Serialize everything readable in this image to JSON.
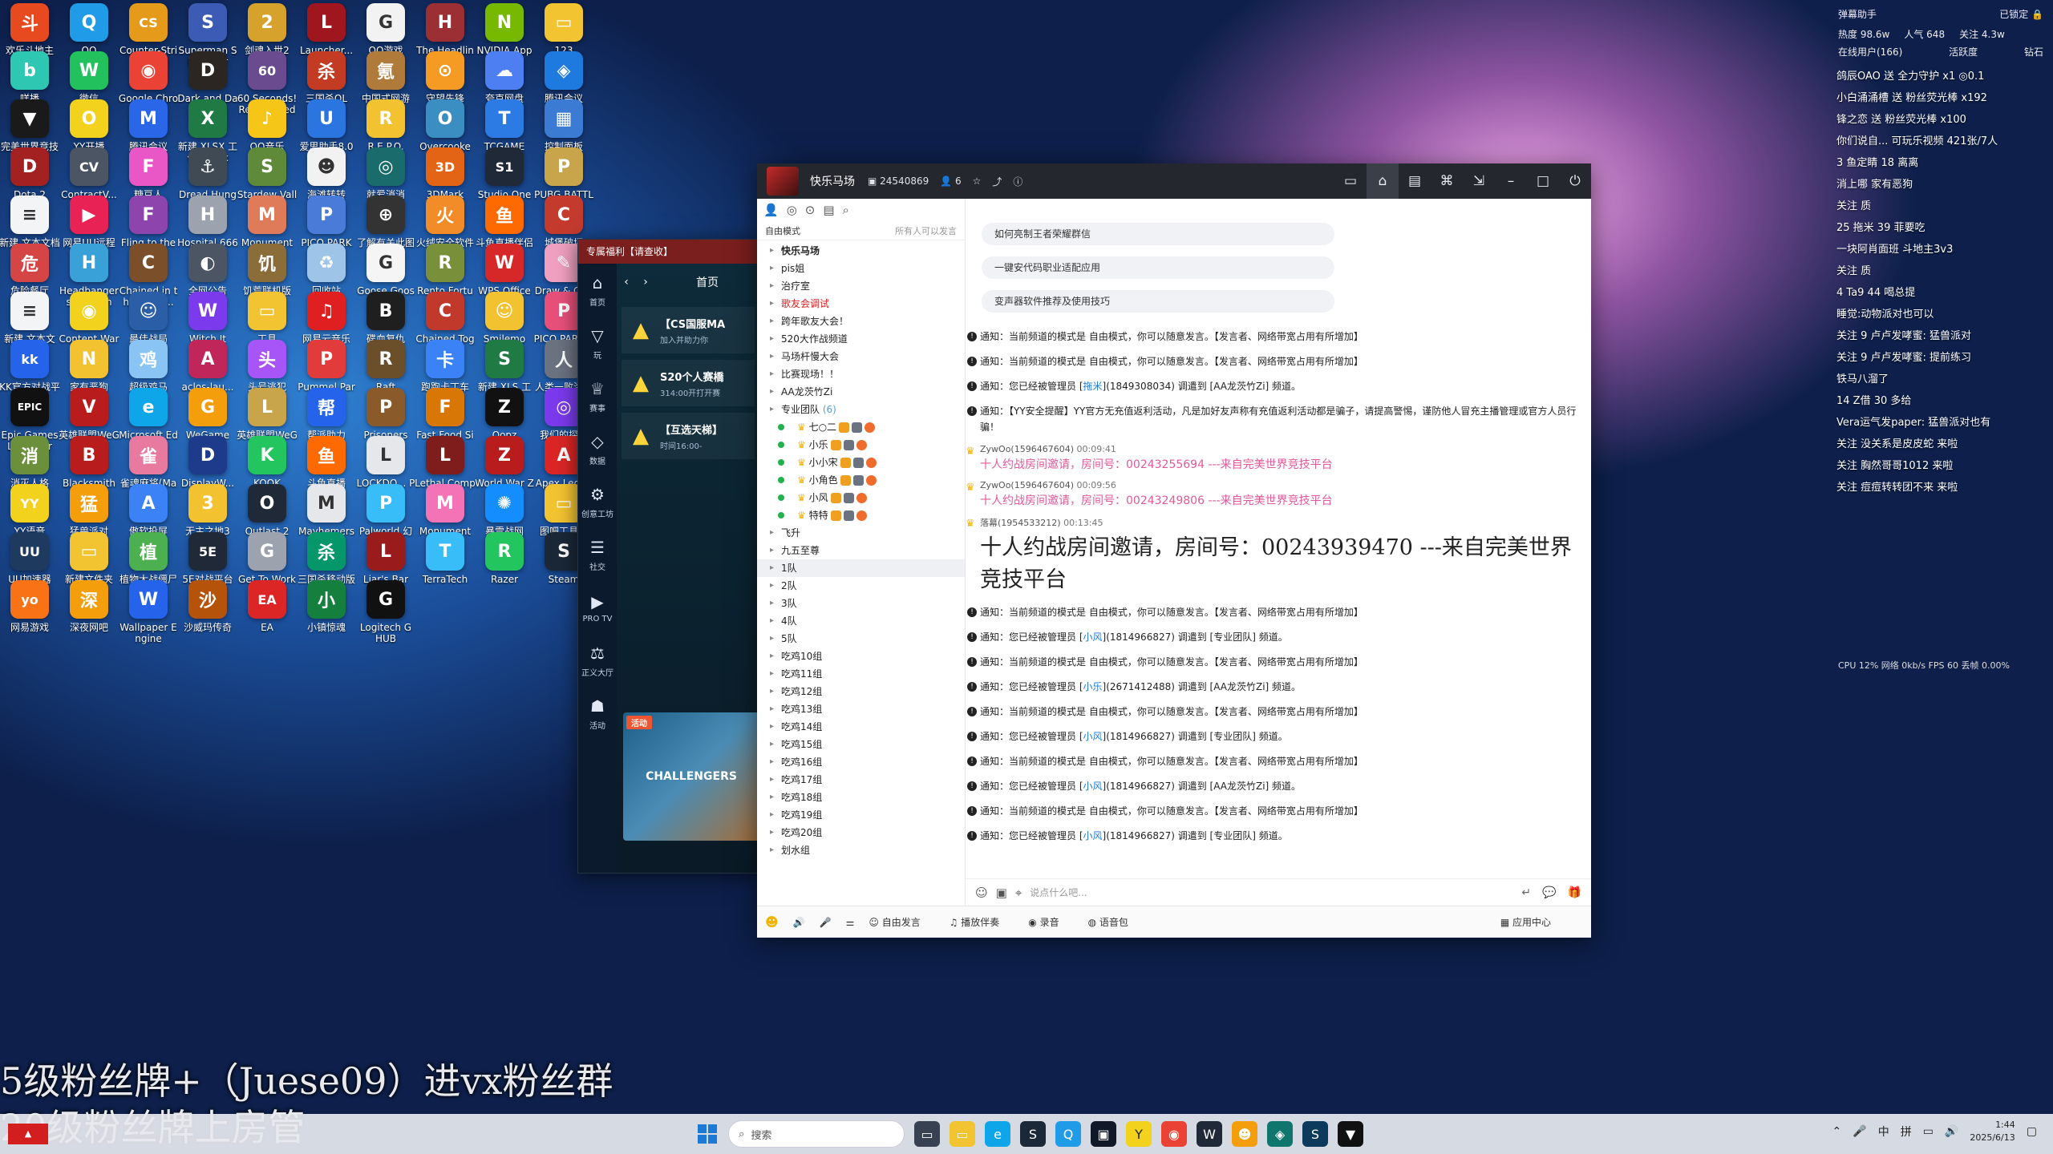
{
  "desktop_icons": [
    {
      "label": "欢乐斗地主",
      "color": "#e84a1f",
      "glyph": "斗"
    },
    {
      "label": "QQ",
      "color": "#1f9be8",
      "glyph": "Q"
    },
    {
      "label": "Counter-Strike 2",
      "color": "#e59a1a",
      "glyph": "CS"
    },
    {
      "label": "Superman Simulator",
      "color": "#3b5bb5",
      "glyph": "S"
    },
    {
      "label": "剑魂入世2",
      "color": "#d7a22b",
      "glyph": "2"
    },
    {
      "label": "Launcher...",
      "color": "#a0161f",
      "glyph": "L"
    },
    {
      "label": "QQ游戏",
      "color": "#f2f2f2",
      "glyph": "G"
    },
    {
      "label": "The Headliners",
      "color": "#9b2f33",
      "glyph": "H"
    },
    {
      "label": "NVIDIA App",
      "color": "#76b900",
      "glyph": "N"
    },
    {
      "label": "123",
      "color": "#f3c431",
      "glyph": "▭"
    },
    {
      "label": "咩播",
      "color": "#2dc7b2",
      "glyph": "b"
    },
    {
      "label": "微信",
      "color": "#22c15e",
      "glyph": "W"
    },
    {
      "label": "Google Chrome",
      "color": "#ea4335",
      "glyph": "◉"
    },
    {
      "label": "Dark and Darker",
      "color": "#2b2622",
      "glyph": "D"
    },
    {
      "label": "60 Seconds! Reatomized",
      "color": "#6a4b8f",
      "glyph": "60"
    },
    {
      "label": "三国杀OL",
      "color": "#c23b22",
      "glyph": "杀"
    },
    {
      "label": "中国式网游",
      "color": "#b07a3a",
      "glyph": "氪"
    },
    {
      "label": "守望先锋",
      "color": "#f59a23",
      "glyph": "⊙"
    },
    {
      "label": "夸克网盘",
      "color": "#4d7ef2",
      "glyph": "☁"
    },
    {
      "label": "腾讯会议",
      "color": "#1f7ae0",
      "glyph": "◈"
    },
    {
      "label": "完美世界竞技平台",
      "color": "#1a1a1a",
      "glyph": "▼"
    },
    {
      "label": "YY开播",
      "color": "#f2d21c",
      "glyph": "O"
    },
    {
      "label": "腾讯会议",
      "color": "#2a66e8",
      "glyph": "M"
    },
    {
      "label": "新建 XLSX 工作表.xlsx",
      "color": "#1f7a43",
      "glyph": "X"
    },
    {
      "label": "QQ音乐",
      "color": "#f5c518",
      "glyph": "♪"
    },
    {
      "label": "爱思助手8.0(64位)",
      "color": "#2a75e0",
      "glyph": "U"
    },
    {
      "label": "R.E.P.O.",
      "color": "#f2c230",
      "glyph": "R"
    },
    {
      "label": "Overcooked! 2",
      "color": "#3a8ec2",
      "glyph": "O"
    },
    {
      "label": "TCGAME",
      "color": "#2c7be5",
      "glyph": "T"
    },
    {
      "label": "控制面板",
      "color": "#3b7bd4",
      "glyph": "▦"
    },
    {
      "label": "Dota 2",
      "color": "#a32120",
      "glyph": "D"
    },
    {
      "label": "ContractV...",
      "color": "#4b5563",
      "glyph": "CV"
    },
    {
      "label": "糖豆人",
      "color": "#e957c7",
      "glyph": "F"
    },
    {
      "label": "Dread Hunger",
      "color": "#3f4a55",
      "glyph": "⚓"
    },
    {
      "label": "Stardew Valley",
      "color": "#5f8a3a",
      "glyph": "S"
    },
    {
      "label": "海滩转转",
      "color": "#f2f2f2",
      "glyph": "☻"
    },
    {
      "label": "就爱消消",
      "color": "#1a6b6b",
      "glyph": "◎"
    },
    {
      "label": "3DMark",
      "color": "#e36414",
      "glyph": "3D"
    },
    {
      "label": "Studio One 5",
      "color": "#1f2937",
      "glyph": "S1"
    },
    {
      "label": "PUBG BATTLEGR...",
      "color": "#c8a44a",
      "glyph": "P"
    },
    {
      "label": "新建 文本文档 (2).txt",
      "color": "#f3f4f6",
      "glyph": "≡"
    },
    {
      "label": "网易UU远程控制",
      "color": "#e82255",
      "glyph": "▶"
    },
    {
      "label": "Fling to the Finish",
      "color": "#8e44ad",
      "glyph": "F"
    },
    {
      "label": "Hospital 666",
      "color": "#9ca3af",
      "glyph": "H"
    },
    {
      "label": "Monument Valley",
      "color": "#e07b5a",
      "glyph": "M"
    },
    {
      "label": "PICO PARK",
      "color": "#4a7bd8",
      "glyph": "P"
    },
    {
      "label": "了解有关此图片的信息",
      "color": "#333",
      "glyph": "⊕"
    },
    {
      "label": "火绒安全软件",
      "color": "#f28c28",
      "glyph": "火"
    },
    {
      "label": "斗鱼直播伴侣",
      "color": "#ff6a00",
      "glyph": "鱼"
    },
    {
      "label": "城堡破坏",
      "color": "#c43b2e",
      "glyph": "C"
    },
    {
      "label": "危险餐厅",
      "color": "#d64545",
      "glyph": "危"
    },
    {
      "label": "Headbangers Rhythm R...",
      "color": "#3aa0d8",
      "glyph": "H"
    },
    {
      "label": "Chained in the Backr...",
      "color": "#7a4f2a",
      "glyph": "C"
    },
    {
      "label": "全网公告",
      "color": "#4b5563",
      "glyph": "◐"
    },
    {
      "label": "饥荒联机版",
      "color": "#8b6d3a",
      "glyph": "饥"
    },
    {
      "label": "回收站",
      "color": "#9ec5e8",
      "glyph": "♻"
    },
    {
      "label": "Goose Goose Duck",
      "color": "#f5f5f5",
      "glyph": "G"
    },
    {
      "label": "Rento Fortune -...",
      "color": "#7a8f3a",
      "glyph": "R"
    },
    {
      "label": "WPS Office",
      "color": "#d62828",
      "glyph": "W"
    },
    {
      "label": "Draw & Guess -...",
      "color": "#f0a0c0",
      "glyph": "✎"
    },
    {
      "label": "新建 文本文档.txt",
      "color": "#f3f4f6",
      "glyph": "≡"
    },
    {
      "label": "Content Warning",
      "color": "#f2d21c",
      "glyph": "◉"
    },
    {
      "label": "最佳战局",
      "color": "#2a5fa8",
      "glyph": "☺"
    },
    {
      "label": "Witch It",
      "color": "#7c3aed",
      "glyph": "W"
    },
    {
      "label": "工具",
      "color": "#f3c431",
      "glyph": "▭"
    },
    {
      "label": "网易云音乐",
      "color": "#e02020",
      "glyph": "♫"
    },
    {
      "label": "碟血复仇",
      "color": "#1f1f1f",
      "glyph": "B"
    },
    {
      "label": "Chained Together",
      "color": "#c0392b",
      "glyph": "C"
    },
    {
      "label": "Smilemo",
      "color": "#f2c230",
      "glyph": "☺"
    },
    {
      "label": "PICO PARK 2",
      "color": "#e8507a",
      "glyph": "P"
    },
    {
      "label": "KK官方对战平台",
      "color": "#2563eb",
      "glyph": "kk"
    },
    {
      "label": "家有恶狗",
      "color": "#f2c230",
      "glyph": "N"
    },
    {
      "label": "超级鸡马",
      "color": "#89c4f4",
      "glyph": "鸡"
    },
    {
      "label": "aclos-lau...",
      "color": "#c0265a",
      "glyph": "A"
    },
    {
      "label": "头号逃犯",
      "color": "#a855f7",
      "glyph": "头"
    },
    {
      "label": "Pummel Party",
      "color": "#e23b3b",
      "glyph": "P"
    },
    {
      "label": "Raft",
      "color": "#6b4f2a",
      "glyph": "R"
    },
    {
      "label": "跑跑卡丁车",
      "color": "#3b82f6",
      "glyph": "卡"
    },
    {
      "label": "新建 XLS 工作表.xls",
      "color": "#1f7a43",
      "glyph": "S"
    },
    {
      "label": "人类一败涂地 Hum...",
      "color": "#6b7280",
      "glyph": "人"
    },
    {
      "label": "Epic Games Launcher",
      "color": "#111",
      "glyph": "EPIC"
    },
    {
      "label": "英雄联盟WeGame版",
      "color": "#b91c1c",
      "glyph": "V"
    },
    {
      "label": "Microsoft Edge",
      "color": "#0ea5e9",
      "glyph": "e"
    },
    {
      "label": "WeGame",
      "color": "#f59e0b",
      "glyph": "G"
    },
    {
      "label": "英雄联盟WeGame版",
      "color": "#c8a44a",
      "glyph": "L"
    },
    {
      "label": "帮派助力",
      "color": "#2563eb",
      "glyph": "帮"
    },
    {
      "label": "Prisoners",
      "color": "#8b5a2b",
      "glyph": "P"
    },
    {
      "label": "Fast Food Simulat...",
      "color": "#d97706",
      "glyph": "F"
    },
    {
      "label": "Oopz",
      "color": "#111",
      "glyph": "Z"
    },
    {
      "label": "我们的探测",
      "color": "#7c3aed",
      "glyph": "◎"
    },
    {
      "label": "消灭人格",
      "color": "#6b8f3a",
      "glyph": "消"
    },
    {
      "label": "Blacksmith",
      "color": "#b91c1c",
      "glyph": "B"
    },
    {
      "label": "雀魂麻将(Mahjong...",
      "color": "#e87aa0",
      "glyph": "雀"
    },
    {
      "label": "DisplayW... Center",
      "color": "#1e3a8a",
      "glyph": "D"
    },
    {
      "label": "KOOK",
      "color": "#22c55e",
      "glyph": "K"
    },
    {
      "label": "斗鱼直播",
      "color": "#ff6a00",
      "glyph": "鱼"
    },
    {
      "label": "LOCKDO... Protocol",
      "color": "#e5e7eb",
      "glyph": "L"
    },
    {
      "label": "Lethal Company",
      "color": "#7f1d1d",
      "glyph": "L"
    },
    {
      "label": "World War Z",
      "color": "#b91c1c",
      "glyph": "Z"
    },
    {
      "label": "Apex Legends",
      "color": "#dc2626",
      "glyph": "A"
    },
    {
      "label": "YY语音",
      "color": "#f2d21c",
      "glyph": "YY"
    },
    {
      "label": "猛兽派对",
      "color": "#f59e0b",
      "glyph": "猛"
    },
    {
      "label": "傲软投屏",
      "color": "#3b82f6",
      "glyph": "A"
    },
    {
      "label": "无主之地3",
      "color": "#f2c230",
      "glyph": "3"
    },
    {
      "label": "Outlast 2",
      "color": "#1f2937",
      "glyph": "O"
    },
    {
      "label": "Mayhemers Demo",
      "color": "#e5e7eb",
      "glyph": "M"
    },
    {
      "label": "Palworld 幻兽帕鲁",
      "color": "#38bdf8",
      "glyph": "P"
    },
    {
      "label": "Monument Valley 2",
      "color": "#f472b6",
      "glyph": "M"
    },
    {
      "label": "暴雪战网",
      "color": "#148eff",
      "glyph": "✺"
    },
    {
      "label": "图吧工具箱",
      "color": "#f3c431",
      "glyph": "▭"
    },
    {
      "label": "UU加速器",
      "color": "#1e3a5f",
      "glyph": "UU"
    },
    {
      "label": "新建文件夹",
      "color": "#f3c431",
      "glyph": "▭"
    },
    {
      "label": "植物大战僵尸杂交版",
      "color": "#4caf50",
      "glyph": "植"
    },
    {
      "label": "5E对战平台",
      "color": "#1f2937",
      "glyph": "5E"
    },
    {
      "label": "Get To Work",
      "color": "#9ca3af",
      "glyph": "G"
    },
    {
      "label": "三国杀移动版",
      "color": "#059669",
      "glyph": "杀"
    },
    {
      "label": "Liar's Bar",
      "color": "#991b1b",
      "glyph": "L"
    },
    {
      "label": "TerraTech",
      "color": "#38bdf8",
      "glyph": "T"
    },
    {
      "label": "Razer",
      "color": "#22c55e",
      "glyph": "R"
    },
    {
      "label": "Steam",
      "color": "#1b2838",
      "glyph": "S"
    },
    {
      "label": "网易游戏",
      "color": "#f97316",
      "glyph": "yo"
    },
    {
      "label": "深夜网吧",
      "color": "#f59e0b",
      "glyph": "深"
    },
    {
      "label": "Wallpaper Engine",
      "color": "#2563eb",
      "glyph": "W"
    },
    {
      "label": "沙威玛传奇",
      "color": "#b45309",
      "glyph": "沙"
    },
    {
      "label": "EA",
      "color": "#dc2626",
      "glyph": "EA"
    },
    {
      "label": "小镇惊魂",
      "color": "#15803d",
      "glyph": "小"
    },
    {
      "label": "Logitech G HUB",
      "color": "#111",
      "glyph": "G"
    }
  ],
  "overlay_lines": [
    "5级粉丝牌+（Juese09）进vx粉丝群",
    "20级粉丝牌上房管"
  ],
  "promo": {
    "title": "专属福利【请查收】",
    "tab_home": "首页",
    "nav": [
      "首页",
      "玩",
      "赛事",
      "数据",
      "创意工坊",
      "社交",
      "PRO TV",
      "正义大厅",
      "活动"
    ],
    "cards": [
      {
        "title": "【CS国服MA",
        "sub": "加入并助力你"
      },
      {
        "title": "S20个人赛橋",
        "sub": "314:00开打开赛"
      },
      {
        "title": "【互选天梯】",
        "sub": "时间16:00-"
      }
    ],
    "banner_tag": "活动",
    "banner_text": "CHALLENGERS"
  },
  "yy": {
    "channel_name": "快乐马场",
    "channel_id": "24540869",
    "online_count": "6",
    "mode_label": "自由模式",
    "mode_right": "所有人可以发言",
    "tree": [
      {
        "t": "快乐马场",
        "cls": "root"
      },
      {
        "t": "pis姐",
        "cls": ""
      },
      {
        "t": "治疗室",
        "cls": ""
      },
      {
        "t": "歌友会调试",
        "cls": "red"
      },
      {
        "t": "跨年歌友大会！",
        "cls": ""
      },
      {
        "t": "520大作战频道",
        "cls": ""
      },
      {
        "t": "马场杆慢大会",
        "cls": ""
      },
      {
        "t": "比赛现场！！",
        "cls": ""
      },
      {
        "t": "AA龙茨竹Zi",
        "cls": ""
      },
      {
        "t": "专业团队",
        "cls": "",
        "cnt": "(6)"
      },
      {
        "t": "七○二",
        "cls": "user"
      },
      {
        "t": "小乐",
        "cls": "user"
      },
      {
        "t": "小小宋",
        "cls": "user"
      },
      {
        "t": "小角色",
        "cls": "user"
      },
      {
        "t": "小风",
        "cls": "user"
      },
      {
        "t": "特特",
        "cls": "user"
      },
      {
        "t": "飞升",
        "cls": ""
      },
      {
        "t": "九五至尊",
        "cls": ""
      },
      {
        "t": "1队",
        "cls": "sel"
      },
      {
        "t": "2队",
        "cls": ""
      },
      {
        "t": "3队",
        "cls": ""
      },
      {
        "t": "4队",
        "cls": ""
      },
      {
        "t": "5队",
        "cls": ""
      },
      {
        "t": "吃鸡10组",
        "cls": ""
      },
      {
        "t": "吃鸡11组",
        "cls": ""
      },
      {
        "t": "吃鸡12组",
        "cls": ""
      },
      {
        "t": "吃鸡13组",
        "cls": ""
      },
      {
        "t": "吃鸡14组",
        "cls": ""
      },
      {
        "t": "吃鸡15组",
        "cls": ""
      },
      {
        "t": "吃鸡16组",
        "cls": ""
      },
      {
        "t": "吃鸡17组",
        "cls": ""
      },
      {
        "t": "吃鸡18组",
        "cls": ""
      },
      {
        "t": "吃鸡19组",
        "cls": ""
      },
      {
        "t": "吃鸡20组",
        "cls": ""
      },
      {
        "t": "划水组",
        "cls": ""
      }
    ],
    "suggestions": [
      "如何亮制王者荣耀群信",
      "一键安代码职业适配应用",
      "变声器软件推荐及使用技巧"
    ],
    "notice_a": "通知：当前频道的模式是 自由模式，你可以随意发言。【发言者、网络带宽占用有所增加】",
    "notice_b1": "通知：您已经被管理员 [",
    "notice_b_link1": "拖米",
    "notice_b2": "](1849308034) 调遣到 [AA龙茨竹Zi] 频道。",
    "notice_c": "通知：【YY安全提醒】YY官方无充值返利活动，凡是加好友声称有充值返利活动都是骗子，请提高警惕，谨防他人冒充主播管理或官方人员行骗！",
    "u1_name": "ZywOo(1596467604)",
    "u1_time1": "00:09:41",
    "u1_msg1": "十人约战房间邀请，房间号：00243255694 ---来自完美世界竞技平台",
    "u1_time2": "00:09:56",
    "u1_msg2": "十人约战房间邀请，房间号：00243249806 ---来自完美世界竞技平台",
    "u2_name": "落幕(1954533212)",
    "u2_time": "00:13:45",
    "u2_msg": "十人约战房间邀请，房间号：00243939470 ---来自完美世界竞技平台",
    "notice_d1": "通知：您已经被管理员 [",
    "notice_d_link": "小风",
    "notice_d2": "](1814966827) 调遣到 [专业团队] 频道。",
    "notice_e_link": "小乐",
    "notice_e2": "](2671412488) 调遣到 [AA龙茨竹Zi] 频道。",
    "notice_f2": "](1814966827) 调遣到 [AA龙茨竹Zi] 频道。",
    "input_placeholder": "说点什么吧...",
    "bottom": [
      "自由发言",
      "播放伴奏",
      "录音",
      "语音包"
    ],
    "bottom_right": "应用中心"
  },
  "danmu": {
    "title": "弹幕助手",
    "locked": "已锁定",
    "stats": [
      "热度 98.6w",
      "人气 648",
      "关注 4.3w"
    ],
    "stats2": [
      "在线用户(166)",
      "活跃度",
      "钻石"
    ],
    "lines": [
      "鸽辰OAO 送 全力守护 x1 ◎0.1",
      "小白涌涌槽 送 粉丝荧光棒 x192",
      "锋之恋 送 粉丝荧光棒 x100",
      "你们说自... 可玩乐视频 421张/7人",
      "3 鱼定睛 18 离离",
      "消上哪 家有恶狗",
      "关注 质",
      "25 拖米 39 菲要吃",
      "一块阿肖面班 斗地主3v3",
      "关注 质",
      "4 Ta9 44 喝总提",
      "睡觉:动物派对也可以",
      "关注 9 卢卢发哮蜜: 猛兽派对",
      "关注 9 卢卢发哮蜜: 提前练习",
      "铁马八溜了",
      "14 Z借 30 多给",
      "Vera运气发paper: 猛兽派对也有",
      "关注 没关系是皮皮蛇 来啦",
      "关注 胸然哥哥1012 来啦",
      "关注 痘痘转转团不来 来啦"
    ],
    "foot": "CPU 12%  网络 0kb/s  FPS 60  丢帧 0.00%"
  },
  "taskbar": {
    "search": "搜索",
    "tray": [
      "中",
      "拼"
    ],
    "time": "1:44",
    "date": "2025/6/13"
  }
}
